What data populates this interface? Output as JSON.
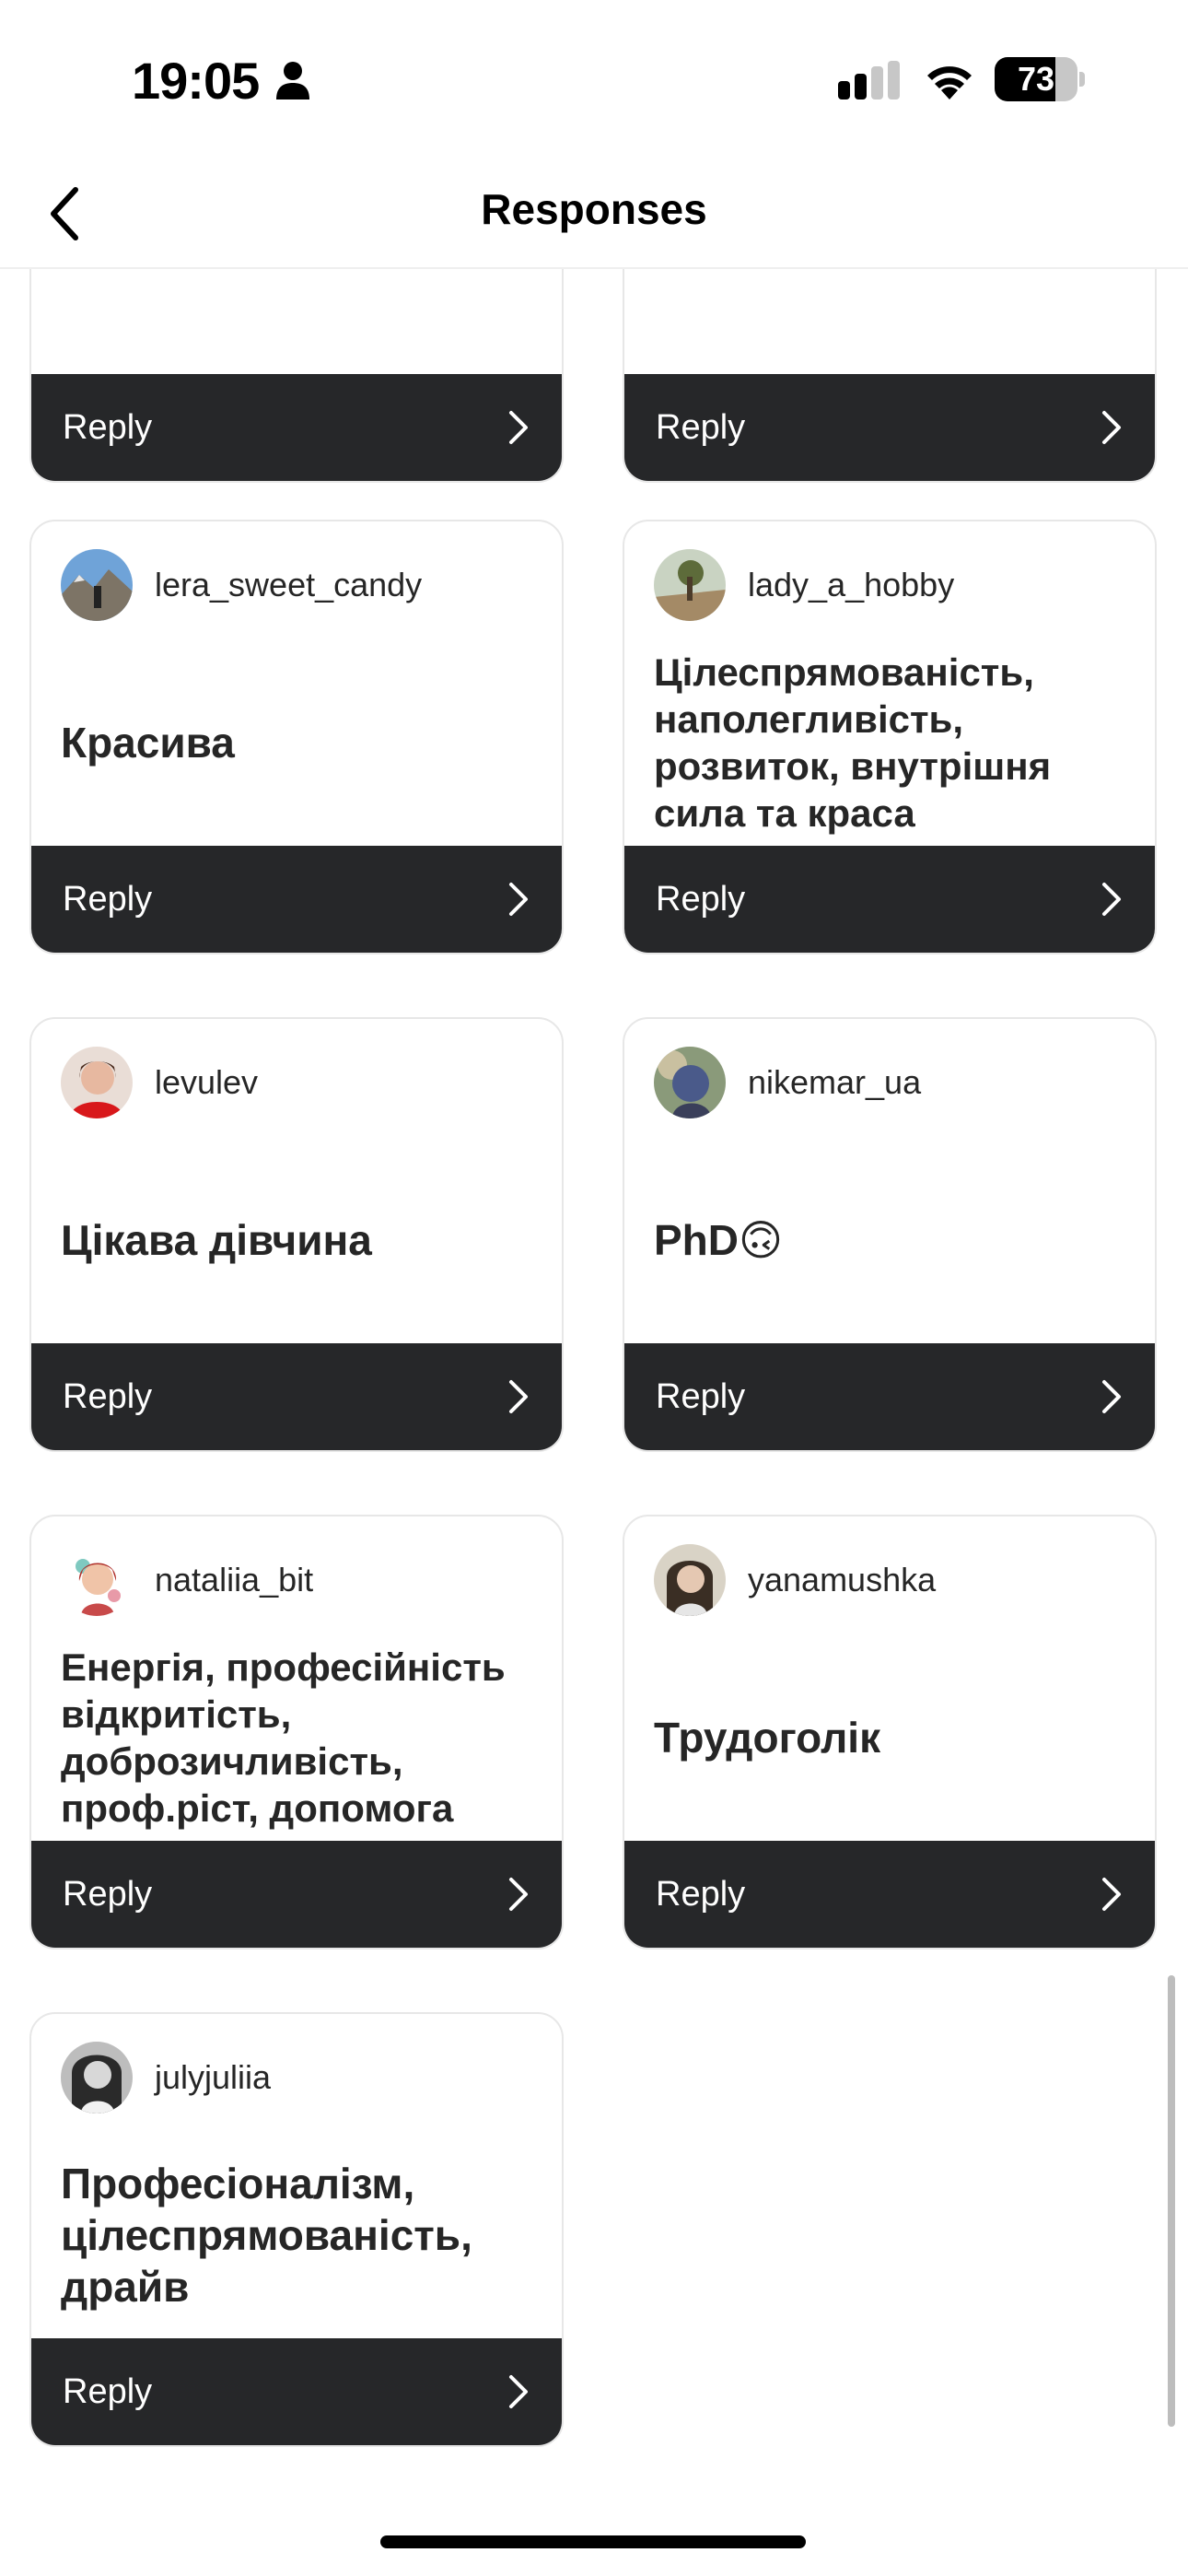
{
  "status_bar": {
    "time": "19:05",
    "battery": "73",
    "battery_level": 0.73
  },
  "header": {
    "title": "Responses"
  },
  "reply_label": "Reply",
  "cards": [
    {
      "username": "",
      "text": ""
    },
    {
      "username": "",
      "text": ""
    },
    {
      "username": "lera_sweet_candy",
      "text": "Красива"
    },
    {
      "username": "lady_a_hobby",
      "text": "Цілеспрямованість, наполегливість, розвиток, внутрішня сила та краса"
    },
    {
      "username": "levulev",
      "text": "Цікава дівчина"
    },
    {
      "username": "nikemar_ua",
      "text": "PhD🙃"
    },
    {
      "username": "nataliia_bit",
      "text": "Енергія, професійність відкритість, доброзичливість, проф.ріст, допомога"
    },
    {
      "username": "yanamushka",
      "text": "Трудоголік"
    },
    {
      "username": "julyjuliia",
      "text": "Професіоналізм, цілеспрямованість, драйв"
    }
  ]
}
